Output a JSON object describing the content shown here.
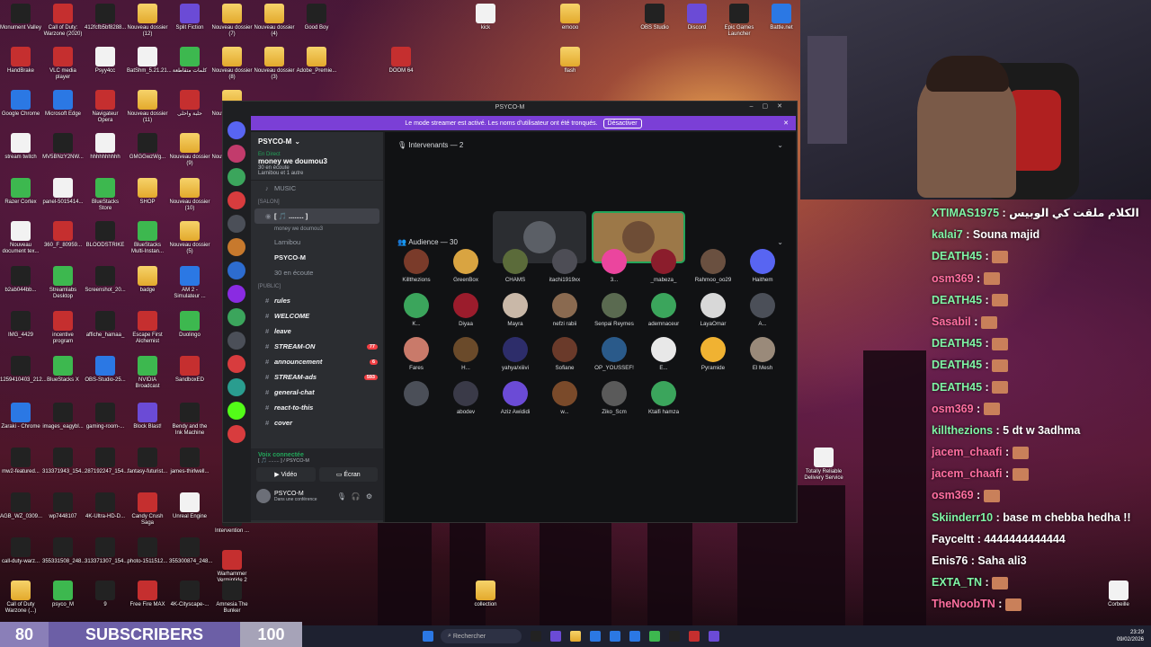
{
  "desktop": {
    "icons": [
      {
        "label": "Monument Valley",
        "type": "dark"
      },
      {
        "label": "Call of Duty: Warzone (2020)",
        "type": "red"
      },
      {
        "label": "412fcfb5bf8288...",
        "type": "dark"
      },
      {
        "label": "Nouveau dossier (12)",
        "type": "folder"
      },
      {
        "label": "Split Fiction",
        "type": "purple"
      },
      {
        "label": "Nouveau dossier (7)",
        "type": "folder"
      },
      {
        "label": "Nouveau dossier (4)",
        "type": "folder"
      },
      {
        "label": "Good Boy",
        "type": "dark"
      },
      {
        "label": "HandBrake",
        "type": "red"
      },
      {
        "label": "VLC media player",
        "type": "red"
      },
      {
        "label": "Psyy4cc",
        "type": "file"
      },
      {
        "label": "BatShm_5.21.21...",
        "type": "file"
      },
      {
        "label": "كلمات متقاطعة",
        "type": "green"
      },
      {
        "label": "Nouveau dossier (8)",
        "type": "folder"
      },
      {
        "label": "Nouveau dossier (3)",
        "type": "folder"
      },
      {
        "label": "Adobe_Premie...",
        "type": "folder"
      },
      {
        "label": "Google Chrome",
        "type": "blue"
      },
      {
        "label": "Microsoft Edge",
        "type": "blue"
      },
      {
        "label": "Navigateur Opera",
        "type": "red"
      },
      {
        "label": "Nouveau dossier (11)",
        "type": "folder"
      },
      {
        "label": "حلبة واحلى",
        "type": "red"
      },
      {
        "label": "Nouveau dossier (6)",
        "type": "folder"
      },
      {
        "label": "stream twitch",
        "type": "file"
      },
      {
        "label": "MV5BNzY2NW...",
        "type": "dark"
      },
      {
        "label": "hhhhhhhhhh",
        "type": "file"
      },
      {
        "label": "GMGGwzWg...",
        "type": "dark"
      },
      {
        "label": "Nouveau dossier (9)",
        "type": "folder"
      },
      {
        "label": "Nouveau dossier (8)",
        "type": "folder"
      },
      {
        "label": "Razer Cortex",
        "type": "green"
      },
      {
        "label": "panel-5015414...",
        "type": "file"
      },
      {
        "label": "BlueStacks Store",
        "type": "green"
      },
      {
        "label": "SHOP",
        "type": "folder"
      },
      {
        "label": "Nouveau dossier (10)",
        "type": "folder"
      },
      {
        "label": "Nouveau document tex...",
        "type": "file"
      },
      {
        "label": "360_F_80959...",
        "type": "red"
      },
      {
        "label": "BLOODSTRIKE",
        "type": "dark"
      },
      {
        "label": "BlueStacks Multi-Instan...",
        "type": "green"
      },
      {
        "label": "Nouveau dossier (5)",
        "type": "folder"
      },
      {
        "label": "b2ab044bb...",
        "type": "dark"
      },
      {
        "label": "Streamlabs Desktop",
        "type": "green"
      },
      {
        "label": "Screenshot_20...",
        "type": "dark"
      },
      {
        "label": "badge",
        "type": "folder"
      },
      {
        "label": "AM 2 - Simulateur ...",
        "type": "blue"
      },
      {
        "label": "IMG_4429",
        "type": "dark"
      },
      {
        "label": "incentive program",
        "type": "red"
      },
      {
        "label": "affiche_hamaa_",
        "type": "dark"
      },
      {
        "label": "Escape First Alchemist",
        "type": "red"
      },
      {
        "label": "Duolingo",
        "type": "green"
      },
      {
        "label": "1259410403_212...",
        "type": "dark"
      },
      {
        "label": "BlueStacks X",
        "type": "green"
      },
      {
        "label": "OBS-Studio-25...",
        "type": "blue"
      },
      {
        "label": "NVIDIA Broadcast",
        "type": "green"
      },
      {
        "label": "SandboxED",
        "type": "red"
      },
      {
        "label": "Zaraki - Chrome",
        "type": "blue"
      },
      {
        "label": "images_eagybl...",
        "type": "dark"
      },
      {
        "label": "gaming-room-...",
        "type": "dark"
      },
      {
        "label": "Block Blast!",
        "type": "purple"
      },
      {
        "label": "Bendy and the Ink Machine",
        "type": "dark"
      },
      {
        "label": "mw2-featured...",
        "type": "dark"
      },
      {
        "label": "313371943_154...",
        "type": "dark"
      },
      {
        "label": "287192247_154...",
        "type": "dark"
      },
      {
        "label": "fantasy-futurist...",
        "type": "dark"
      },
      {
        "label": "james-thirlwell...",
        "type": "dark"
      },
      {
        "label": "AGB_WZ_0309...",
        "type": "dark"
      },
      {
        "label": "wp7448107",
        "type": "dark"
      },
      {
        "label": "4K-Ultra-HD-D...",
        "type": "dark"
      },
      {
        "label": "Candy Crush Saga",
        "type": "red"
      },
      {
        "label": "Unreal Engine",
        "type": "file"
      },
      {
        "label": "call-duty-warz...",
        "type": "dark"
      },
      {
        "label": "355331508_248...",
        "type": "dark"
      },
      {
        "label": "313371307_154...",
        "type": "dark"
      },
      {
        "label": "photo-1511512...",
        "type": "dark"
      },
      {
        "label": "355300874_248...",
        "type": "dark"
      },
      {
        "label": "Call of Duty Warzone (...)",
        "type": "folder"
      },
      {
        "label": "psyco_M",
        "type": "green"
      },
      {
        "label": "9",
        "type": "dark"
      },
      {
        "label": "Free Fire MAX",
        "type": "red"
      },
      {
        "label": "4K-Cityscape-...",
        "type": "dark"
      },
      {
        "label": "kick",
        "type": "file"
      },
      {
        "label": "emooo",
        "type": "folder"
      },
      {
        "label": "flash",
        "type": "folder"
      },
      {
        "label": "DOOM 64",
        "type": "red"
      },
      {
        "label": "OBS Studio",
        "type": "dark"
      },
      {
        "label": "Discord",
        "type": "purple"
      },
      {
        "label": "Epic Games Launcher",
        "type": "dark"
      },
      {
        "label": "Battle.net",
        "type": "blue"
      },
      {
        "label": "Intervention ...",
        "type": "dark"
      },
      {
        "label": "Warhammer Vermintide 2",
        "type": "red"
      },
      {
        "label": "Amnesia The Bunker",
        "type": "dark"
      },
      {
        "label": "Totally Reliable Delivery Service",
        "type": "file"
      },
      {
        "label": "collection",
        "type": "folder"
      },
      {
        "label": "Corbeille",
        "type": "file"
      }
    ]
  },
  "discord": {
    "window_title": "PSYCO-M",
    "banner": {
      "text": "Le mode streamer est activé. Les noms d'utilisateur ont été tronqués.",
      "button": "Désactiver"
    },
    "server_name": "PSYCO-M",
    "event": {
      "status": "En Direct",
      "title": "money we doumou3",
      "members": "Larnibou et 1 autre",
      "listening": "30 en écoute"
    },
    "music_label": "MUSIC",
    "section_salons": "[salon]",
    "stage": {
      "name": "[ 🎵 ........ ]",
      "subtitle": "money we doumou3",
      "users": [
        "Larnibou",
        "PSYCO-M",
        "30 en écoute"
      ]
    },
    "section_public": "[Public]",
    "channels": [
      {
        "name": "rules",
        "badge": ""
      },
      {
        "name": "WELCOME",
        "badge": ""
      },
      {
        "name": "leave",
        "badge": ""
      },
      {
        "name": "STREAM-ON",
        "badge": "77"
      },
      {
        "name": "announcement",
        "badge": "6"
      },
      {
        "name": "STREAM-ads",
        "badge": "593"
      },
      {
        "name": "general-chat",
        "badge": ""
      },
      {
        "name": "react-to-this",
        "badge": ""
      },
      {
        "name": "cover",
        "badge": ""
      }
    ],
    "voice_panel": {
      "status": "Voix connectée",
      "channel": "[ 🎵 ........ ] / PSYCO-M",
      "video": "Vidéo",
      "screen": "Écran"
    },
    "user_panel": {
      "name": "PSYCO-M",
      "status": "Dans une conférence"
    },
    "speakers_header": "Intervenants — 2",
    "audience_header": "Audience — 30",
    "audience": [
      "Killthezions",
      "GreenBox",
      "CHAMS",
      "itachi1919xx",
      "3...",
      "_mabeza_",
      "Rahmoo_oo29",
      "Haithem",
      "K...",
      "Diyaa",
      "Mayra",
      "nefzi rabii",
      "Senpai Reymes",
      "ademnaceur",
      "LayaOmar",
      "A...",
      "Fares",
      "H...",
      "yahya/xiiivi",
      "Sofiane",
      "OP_YOUSSEF!",
      "E...",
      "Pyramide",
      "El Mesh",
      "",
      "abodev",
      "Aziz Awididi",
      "w...",
      "Ziko_Scm",
      "Ktaifi hamza"
    ]
  },
  "chat": [
    {
      "user": "XTIMAS1975",
      "text": " : الكلام ملقت كي الوبيس",
      "color": "green"
    },
    {
      "user": "kalai7",
      "text": " : Souna majid",
      "color": "green"
    },
    {
      "user": "DEATH45",
      "text": " : ",
      "color": "green",
      "emote": true
    },
    {
      "user": "osm369",
      "text": " : ",
      "color": "pink",
      "emote": true
    },
    {
      "user": "DEATH45",
      "text": " : ",
      "color": "green",
      "emote": true
    },
    {
      "user": "Sasabil",
      "text": " : ",
      "color": "pink",
      "emote": true
    },
    {
      "user": "DEATH45",
      "text": " : ",
      "color": "green",
      "emote": true
    },
    {
      "user": "DEATH45",
      "text": " : ",
      "color": "green",
      "emote": true
    },
    {
      "user": "DEATH45",
      "text": " : ",
      "color": "green",
      "emote": true
    },
    {
      "user": "osm369",
      "text": " : ",
      "color": "pink",
      "emote": true
    },
    {
      "user": "killthezions",
      "text": " : 5 dt w 3adhma",
      "color": "green"
    },
    {
      "user": "jacem_chaafi",
      "text": " : ",
      "color": "pink",
      "emote": true
    },
    {
      "user": "jacem_chaafi",
      "text": " : ",
      "color": "pink",
      "emote": true
    },
    {
      "user": "osm369",
      "text": " : ",
      "color": "pink",
      "emote": true
    },
    {
      "user": "Skiinderr10",
      "text": " : base m chebba hedha !!",
      "color": "green"
    },
    {
      "user": "Fayceltt",
      "text": " : 4444444444444",
      "color": "white"
    },
    {
      "user": "Enis76",
      "text": " : Saha ali3",
      "color": "white"
    },
    {
      "user": "EXTA_TN",
      "text": " : ",
      "color": "green",
      "emote": true
    },
    {
      "user": "TheNoobTN",
      "text": " : ",
      "color": "pink",
      "emote": true
    }
  ],
  "counter": {
    "left": "80",
    "label": "SUBSCRIBERS",
    "right": "100"
  },
  "taskbar": {
    "search": "Rechercher",
    "time": "23:29",
    "date": "09/02/2026"
  }
}
